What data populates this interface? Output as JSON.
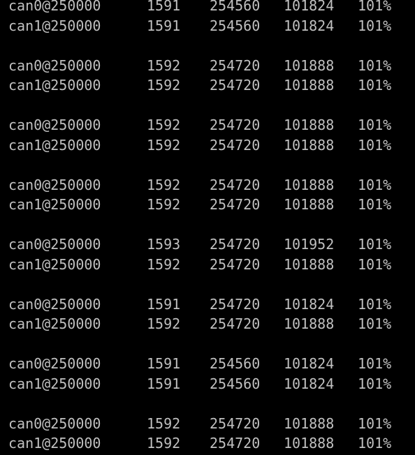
{
  "terminal": {
    "colors": {
      "background": "#000000",
      "text": "#c0c0c0"
    },
    "groups": [
      {
        "lines": [
          {
            "iface": "can0@250000",
            "frames": "1591",
            "bits": "254560",
            "bitstuff": "101824",
            "load": "101%"
          },
          {
            "iface": "can1@250000",
            "frames": "1591",
            "bits": "254560",
            "bitstuff": "101824",
            "load": "101%"
          }
        ]
      },
      {
        "lines": [
          {
            "iface": "can0@250000",
            "frames": "1592",
            "bits": "254720",
            "bitstuff": "101888",
            "load": "101%"
          },
          {
            "iface": "can1@250000",
            "frames": "1592",
            "bits": "254720",
            "bitstuff": "101888",
            "load": "101%"
          }
        ]
      },
      {
        "lines": [
          {
            "iface": "can0@250000",
            "frames": "1592",
            "bits": "254720",
            "bitstuff": "101888",
            "load": "101%"
          },
          {
            "iface": "can1@250000",
            "frames": "1592",
            "bits": "254720",
            "bitstuff": "101888",
            "load": "101%"
          }
        ]
      },
      {
        "lines": [
          {
            "iface": "can0@250000",
            "frames": "1592",
            "bits": "254720",
            "bitstuff": "101888",
            "load": "101%"
          },
          {
            "iface": "can1@250000",
            "frames": "1592",
            "bits": "254720",
            "bitstuff": "101888",
            "load": "101%"
          }
        ]
      },
      {
        "lines": [
          {
            "iface": "can0@250000",
            "frames": "1593",
            "bits": "254720",
            "bitstuff": "101952",
            "load": "101%"
          },
          {
            "iface": "can1@250000",
            "frames": "1592",
            "bits": "254720",
            "bitstuff": "101888",
            "load": "101%"
          }
        ]
      },
      {
        "lines": [
          {
            "iface": "can0@250000",
            "frames": "1591",
            "bits": "254720",
            "bitstuff": "101824",
            "load": "101%"
          },
          {
            "iface": "can1@250000",
            "frames": "1592",
            "bits": "254720",
            "bitstuff": "101888",
            "load": "101%"
          }
        ]
      },
      {
        "lines": [
          {
            "iface": "can0@250000",
            "frames": "1591",
            "bits": "254560",
            "bitstuff": "101824",
            "load": "101%"
          },
          {
            "iface": "can1@250000",
            "frames": "1591",
            "bits": "254560",
            "bitstuff": "101824",
            "load": "101%"
          }
        ]
      },
      {
        "lines": [
          {
            "iface": "can0@250000",
            "frames": "1592",
            "bits": "254720",
            "bitstuff": "101888",
            "load": "101%"
          },
          {
            "iface": "can1@250000",
            "frames": "1592",
            "bits": "254720",
            "bitstuff": "101888",
            "load": "101%"
          }
        ]
      }
    ]
  }
}
